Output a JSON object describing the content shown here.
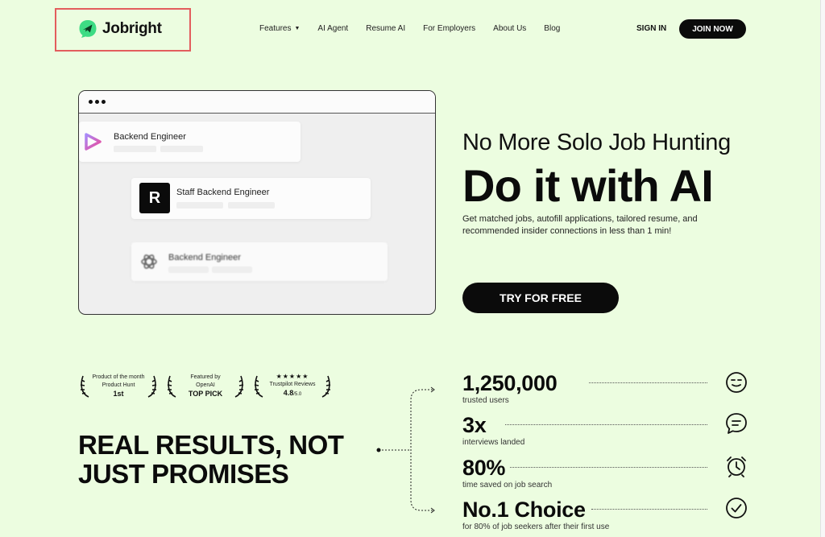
{
  "header": {
    "logo_text": "Jobright",
    "nav": [
      "Features",
      "AI Agent",
      "Resume AI",
      "For Employers",
      "About Us",
      "Blog"
    ],
    "sign_in": "SIGN IN",
    "join": "JOIN NOW"
  },
  "mock": {
    "cards": [
      {
        "title": "Backend Engineer"
      },
      {
        "title": "Staff Backend Engineer",
        "icon_letter": "R"
      },
      {
        "title": "Backend Engineer"
      }
    ]
  },
  "hero": {
    "subtitle": "No More Solo Job Hunting",
    "title": "Do it with AI",
    "description": "Get matched jobs, autofill applications, tailored resume, and recommended insider connections in less than 1 min!",
    "cta": "TRY FOR FREE"
  },
  "awards": [
    {
      "top": "Product of the month",
      "top2": "Product Hunt",
      "main": "1st"
    },
    {
      "top": "Featured by",
      "top2": "OpenAI",
      "main": "TOP PICK"
    },
    {
      "stars": "★★★★★",
      "top": "Trustpilot Reviews",
      "main": "4.8",
      "sub": "/5.0"
    }
  ],
  "headline": {
    "line1": "REAL RESULTS, NOT",
    "line2": "JUST PROMISES"
  },
  "stats": [
    {
      "value": "1,250,000",
      "label": "trusted users",
      "icon": "smile-icon"
    },
    {
      "value": "3x",
      "label": "interviews landed",
      "icon": "chat-icon"
    },
    {
      "value": "80%",
      "label": "time saved on job search",
      "icon": "alarm-clock-icon"
    },
    {
      "value": "No.1 Choice",
      "label": "for 80% of job seekers after their first use",
      "icon": "check-circle-icon"
    }
  ],
  "colors": {
    "background": "#ecfde0",
    "brand_green": "#3ddc84",
    "dark": "#0b0b0b",
    "highlight_box": "#e35d5d"
  }
}
